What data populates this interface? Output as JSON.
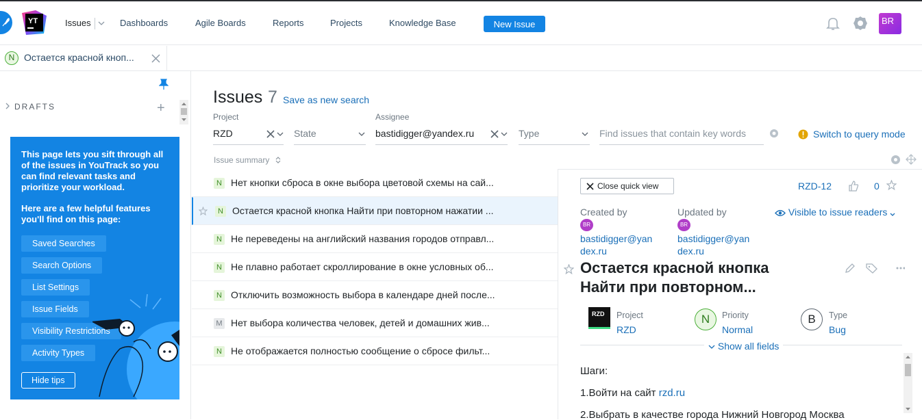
{
  "nav": {
    "issues": "Issues",
    "dashboards": "Dashboards",
    "agile_boards": "Agile Boards",
    "reports": "Reports",
    "projects": "Projects",
    "knowledge_base": "Knowledge Base",
    "new_issue": "New Issue",
    "logo_text": "YT",
    "avatar": "BR"
  },
  "tab": {
    "badge": "N",
    "label": "Остается красной кноп..."
  },
  "sidebar": {
    "drafts_label": "DRAFTS",
    "tips_intro": "This page lets you sift through all of the issues in YouTrack so you can find relevant tasks and prioritize your workload.",
    "tips_features": "Here are a few helpful features you'll find on this page:",
    "tip_buttons": [
      "Saved Searches",
      "Search Options",
      "List Settings",
      "Issue Fields",
      "Visibility Restrictions",
      "Activity Types"
    ],
    "hide_tips": "Hide tips"
  },
  "main": {
    "title": "Issues",
    "count": "7",
    "save_search": "Save as new search",
    "filters": {
      "project_label": "Project",
      "project_value": "RZD",
      "state_placeholder": "State",
      "assignee_label": "Assignee",
      "assignee_value": "bastidigger@yandex.ru",
      "type_placeholder": "Type",
      "search_placeholder": "Find issues that contain key words"
    },
    "query_mode": "Switch to query mode",
    "sort_label": "Issue summary"
  },
  "issues": [
    {
      "badge": "N",
      "summary": "Нет кнопки сброса в окне выбора цветовой схемы на сай..."
    },
    {
      "badge": "N",
      "summary": "Остается красной кнопка Найти при повторном нажатии ..."
    },
    {
      "badge": "N",
      "summary": "Не переведены на английский названия городов отправл..."
    },
    {
      "badge": "N",
      "summary": "Не плавно работает скроллирование в окне условных об..."
    },
    {
      "badge": "N",
      "summary": "Отключить возможность выбора в календаре дней после..."
    },
    {
      "badge": "M",
      "summary": "Нет выбора количества человек, детей и домашних жив..."
    },
    {
      "badge": "N",
      "summary": "Не отображается полностью сообщение о сбросе фильт..."
    }
  ],
  "quick_view": {
    "close_label": "Close quick view",
    "issue_id": "RZD-12",
    "votes": "0",
    "created_by_label": "Created by",
    "updated_by_label": "Updated by",
    "user_avatar": "BR",
    "created_by": "bastidigger@yandex.ru",
    "updated_by": "bastidigger@yandex.ru",
    "visibility": "Visible to issue readers",
    "title": "Остается красной кнопка Найти при повторном...",
    "project_label": "Project",
    "project_value": "RZD",
    "project_icon": "RZD",
    "priority_label": "Priority",
    "priority_value": "Normal",
    "priority_icon": "N",
    "type_label": "Type",
    "type_value": "Bug",
    "type_icon": "B",
    "show_all": "Show all fields",
    "body_line1": "Шаги:",
    "body_line2_prefix": "1.Войти на сайт ",
    "body_line2_link": "rzd.ru",
    "body_line3": "2.Выбрать в качестве города Нижний Новгород Москва"
  },
  "colors": {
    "accent": "#1384e3",
    "link": "#1a6fb8",
    "normal_priority": "#4caf3a",
    "avatar": "#b03ec8"
  }
}
